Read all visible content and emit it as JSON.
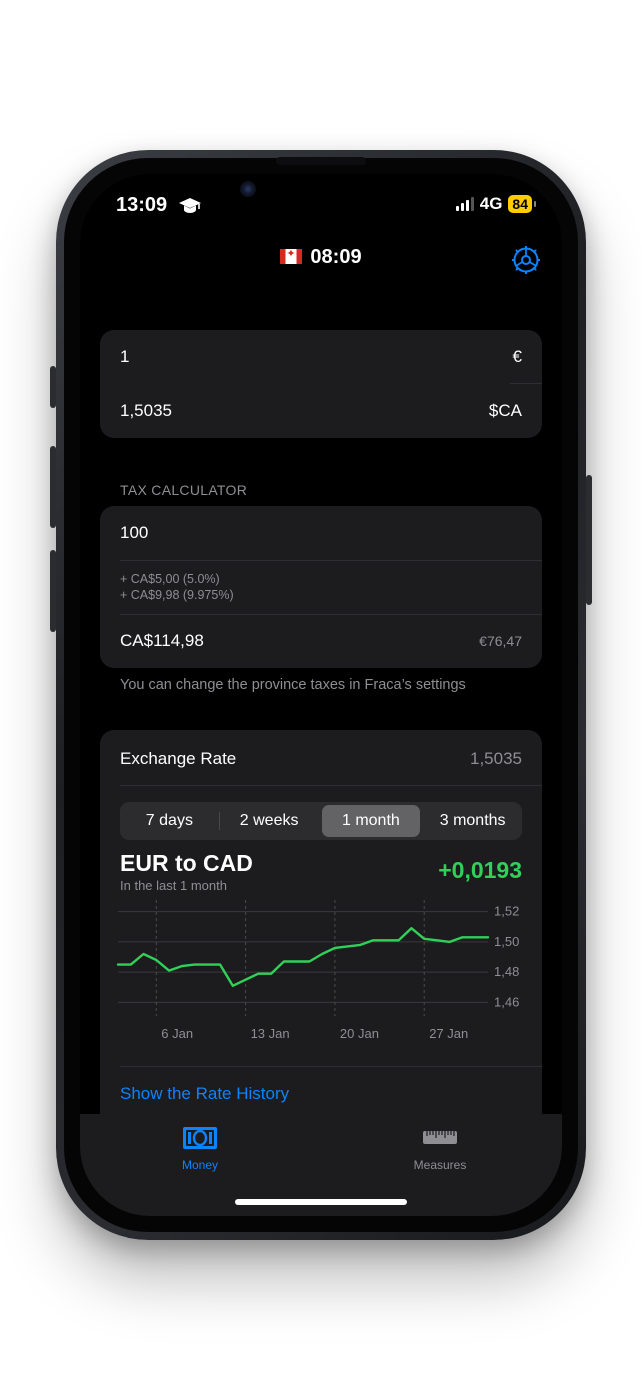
{
  "status_bar": {
    "time": "13:09",
    "network": "4G",
    "battery": "84"
  },
  "nav": {
    "title": "08:09"
  },
  "converter": {
    "amount": "1",
    "amount_currency": "€",
    "result": "1,5035",
    "result_currency": "$CA"
  },
  "tax": {
    "header": "TAX CALCULATOR",
    "input": "100",
    "tax_line_1": "+ CA$5,00 (5.0%)",
    "tax_line_2": "+ CA$9,98 (9.975%)",
    "total": "CA$114,98",
    "total_eur": "€76,47",
    "footer": "You can change the province taxes in Fraca’s settings"
  },
  "exchange": {
    "label": "Exchange Rate",
    "value": "1,5035",
    "segments": [
      "7 days",
      "2 weeks",
      "1 month",
      "3 months"
    ],
    "selected_segment": "1 month",
    "pair": "EUR to CAD",
    "period_caption": "In the last 1 month",
    "change": "+0,0193",
    "history_link": "Show the Rate History"
  },
  "chart_data": {
    "type": "line",
    "x": [
      "3 Jan",
      "4 Jan",
      "5 Jan",
      "6 Jan",
      "7 Jan",
      "8 Jan",
      "9 Jan",
      "10 Jan",
      "11 Jan",
      "12 Jan",
      "13 Jan",
      "14 Jan",
      "15 Jan",
      "16 Jan",
      "17 Jan",
      "18 Jan",
      "19 Jan",
      "20 Jan",
      "21 Jan",
      "22 Jan",
      "23 Jan",
      "24 Jan",
      "25 Jan",
      "26 Jan",
      "27 Jan",
      "28 Jan",
      "29 Jan",
      "30 Jan",
      "31 Jan",
      "1 Feb"
    ],
    "values": [
      1.485,
      1.485,
      1.492,
      1.488,
      1.481,
      1.484,
      1.485,
      1.485,
      1.485,
      1.471,
      1.475,
      1.479,
      1.479,
      1.487,
      1.487,
      1.487,
      1.492,
      1.496,
      1.497,
      1.498,
      1.501,
      1.501,
      1.501,
      1.509,
      1.502,
      1.501,
      1.5,
      1.503,
      1.503,
      1.503
    ],
    "x_tick_labels": [
      "6 Jan",
      "13 Jan",
      "20 Jan",
      "27 Jan"
    ],
    "x_tick_index": [
      3,
      10,
      17,
      24
    ],
    "y_ticks": [
      1.52,
      1.5,
      1.48,
      1.46
    ],
    "y_tick_labels": [
      "1,52",
      "1,50",
      "1,48",
      "1,46"
    ],
    "ylim": [
      1.455,
      1.525
    ],
    "line_color": "#30d158",
    "grid": true
  },
  "tabs": [
    {
      "label": "Money",
      "icon": "banknote-icon",
      "active": true
    },
    {
      "label": "Measures",
      "icon": "ruler-icon",
      "active": false
    }
  ],
  "colors": {
    "accent": "#0a84ff",
    "positive": "#30d158",
    "card": "#1c1c1e",
    "battery": "#ffcc00"
  }
}
